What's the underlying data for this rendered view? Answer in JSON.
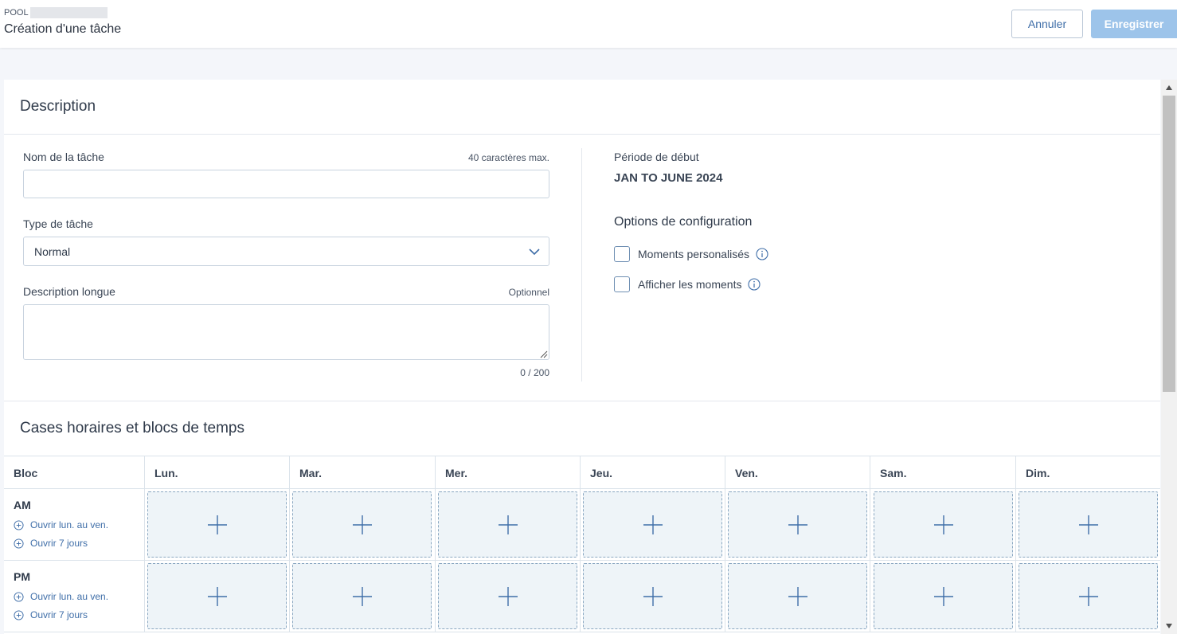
{
  "header": {
    "pool_label": "POOL",
    "title": "Création d'une tâche",
    "cancel_label": "Annuler",
    "save_label": "Enregistrer"
  },
  "description": {
    "section_title": "Description",
    "task_name": {
      "label": "Nom de la tâche",
      "hint": "40 caractères max.",
      "value": "",
      "placeholder": ""
    },
    "task_type": {
      "label": "Type de tâche",
      "selected": "Normal"
    },
    "long_description": {
      "label": "Description longue",
      "hint": "Optionnel",
      "value": "",
      "counter": "0 / 200"
    },
    "period": {
      "label": "Période de début",
      "value": "JAN TO JUNE 2024"
    },
    "options": {
      "title": "Options de configuration",
      "items": [
        {
          "label": "Moments personalisés",
          "checked": false
        },
        {
          "label": "Afficher les moments",
          "checked": false
        }
      ]
    }
  },
  "schedule": {
    "section_title": "Cases horaires et blocs de temps",
    "columns": [
      "Bloc",
      "Lun.",
      "Mar.",
      "Mer.",
      "Jeu.",
      "Ven.",
      "Sam.",
      "Dim."
    ],
    "rows": [
      {
        "name": "AM",
        "link_weekdays": "Ouvrir lun. au ven.",
        "link_all": "Ouvrir 7 jours"
      },
      {
        "name": "PM",
        "link_weekdays": "Ouvrir lun. au ven.",
        "link_all": "Ouvrir 7 jours"
      }
    ]
  },
  "icons": {
    "chevron": "chevron-down-icon",
    "info": "info-icon",
    "add": "plus-icon",
    "open": "circle-plus-icon"
  },
  "colors": {
    "accent": "#3f6ea8",
    "save_disabled": "#9dc4ea",
    "slot_bg": "#eef4f8",
    "slot_border": "#8aa7c1"
  }
}
